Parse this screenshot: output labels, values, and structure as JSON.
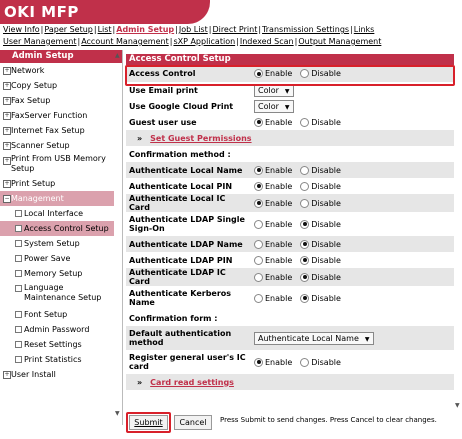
{
  "brand": "OKI MFP",
  "colors": {
    "accent": "#c0304a",
    "highlight": "#d8202a"
  },
  "nav_row1": [
    {
      "label": "View Info",
      "active": false
    },
    {
      "label": "Paper Setup",
      "active": false
    },
    {
      "label": "List",
      "active": false
    },
    {
      "label": "Admin Setup",
      "active": true
    },
    {
      "label": "Job List",
      "active": false
    },
    {
      "label": "Direct Print",
      "active": false
    },
    {
      "label": "Transmission Settings",
      "active": false
    },
    {
      "label": "Links",
      "active": false
    }
  ],
  "nav_row2": [
    {
      "label": "User Management"
    },
    {
      "label": "Account Management"
    },
    {
      "label": "sXP Application"
    },
    {
      "label": "Indexed Scan"
    },
    {
      "label": "Output Management"
    }
  ],
  "sidebar": {
    "title": "Admin Setup",
    "items": [
      {
        "label": "Network",
        "icon": "plus-icon"
      },
      {
        "label": "Copy Setup",
        "icon": "plus-icon"
      },
      {
        "label": "Fax Setup",
        "icon": "plus-icon"
      },
      {
        "label": "FaxServer Function",
        "icon": "plus-icon"
      },
      {
        "label": "Internet Fax Setup",
        "icon": "plus-icon"
      },
      {
        "label": "Scanner Setup",
        "icon": "plus-icon"
      },
      {
        "label": "Print From USB Memory Setup",
        "icon": "plus-icon"
      },
      {
        "label": "Print Setup",
        "icon": "plus-icon"
      },
      {
        "label": "Management",
        "icon": "minus-icon"
      },
      {
        "label": "Local Interface"
      },
      {
        "label": "Access Control Setup"
      },
      {
        "label": "System Setup"
      },
      {
        "label": "Power Save"
      },
      {
        "label": "Memory Setup"
      },
      {
        "label": "Language Maintenance Setup"
      },
      {
        "label": "Font Setup"
      },
      {
        "label": "Admin Password"
      },
      {
        "label": "Reset Settings"
      },
      {
        "label": "Print Statistics"
      },
      {
        "label": "User Install",
        "icon": "plus-icon"
      }
    ]
  },
  "section_title": "Access Control Setup",
  "opts": {
    "enable": "Enable",
    "disable": "Disable"
  },
  "rows": {
    "access_control": {
      "label": "Access Control",
      "value": "Enable"
    },
    "use_email_print": {
      "label": "Use Email print",
      "value": "Color"
    },
    "use_google_cloud": {
      "label": "Use Google Cloud Print",
      "value": "Color"
    },
    "guest_user": {
      "label": "Guest user use",
      "value": "Enable"
    },
    "guest_link": "Set Guest Permissions",
    "confirm_method": "Confirmation method :",
    "auth_local_name": {
      "label": "Authenticate Local Name",
      "value": "Enable"
    },
    "auth_local_pin": {
      "label": "Authenticate Local PIN",
      "value": "Enable"
    },
    "auth_local_ic": {
      "label": "Authenticate Local IC Card",
      "value": "Enable"
    },
    "auth_ldap_sso": {
      "label": "Authenticate LDAP Single Sign-On",
      "value": "Disable"
    },
    "auth_ldap_name": {
      "label": "Authenticate LDAP Name",
      "value": "Disable"
    },
    "auth_ldap_pin": {
      "label": "Authenticate LDAP PIN",
      "value": "Disable"
    },
    "auth_ldap_ic": {
      "label": "Authenticate LDAP IC Card",
      "value": "Disable"
    },
    "auth_kerberos": {
      "label": "Authenticate Kerberos Name",
      "value": "Disable"
    },
    "confirm_form": "Confirmation form :",
    "default_auth": {
      "label": "Default authentication method",
      "value": "Authenticate Local Name"
    },
    "register_ic": {
      "label": "Register general user's IC card",
      "value": "Enable"
    },
    "card_link": "Card read settings"
  },
  "footer": {
    "submit": "Submit",
    "cancel": "Cancel",
    "note": "Press Submit to send changes. Press Cancel to clear changes."
  }
}
